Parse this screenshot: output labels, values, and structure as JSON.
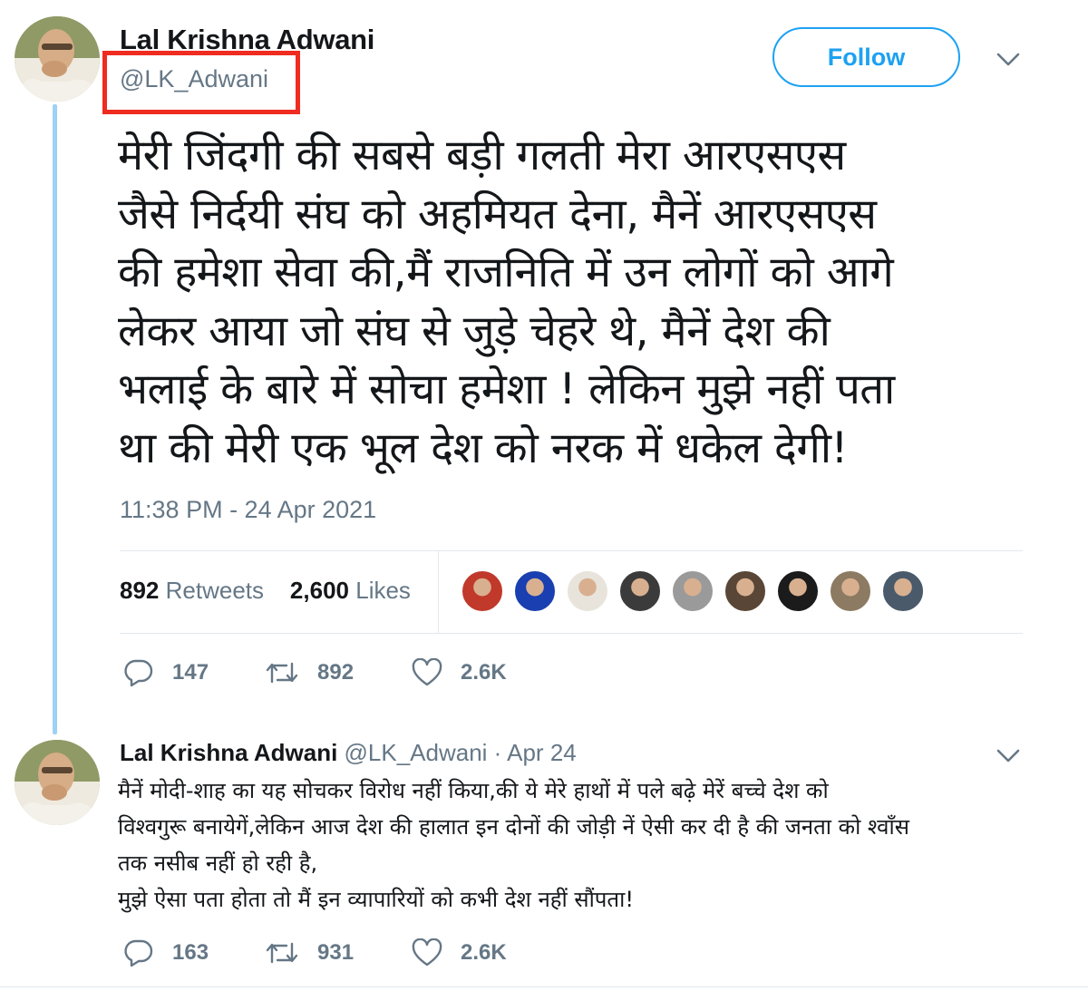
{
  "main_tweet": {
    "author_name": "Lal Krishna Adwani",
    "handle": "@LK_Adwani",
    "follow_label": "Follow",
    "text": "मेरी जिंदगी की सबसे बड़ी गलती मेरा आरएसएस\nजैसे निर्दयी संघ को अहमियत देना,  मैनें आरएसएस\nकी हमेशा सेवा की,मैं राजनिति में उन लोगों को आगे\nलेकर आया जो संघ से जुड़े चेहरे थे, मैनें देश की\nभलाई के बारे में सोचा हमेशा ! लेकिन मुझे नहीं पता\nथा की मेरी एक भूल देश को नरक में धकेल देगी!",
    "timestamp": "11:38 PM - 24 Apr 2021",
    "retweets_count": "892",
    "retweets_label": "Retweets",
    "likes_count": "2,600",
    "likes_label": "Likes",
    "actions": {
      "replies": "147",
      "retweets": "892",
      "likes": "2.6K"
    },
    "liker_avatar_colors": [
      "#c0392b",
      "#1a3fb0",
      "#e8e4dc",
      "#3b3b3b",
      "#9a9a9a",
      "#5a4636",
      "#1b1b1b",
      "#8c7a62",
      "#4a5a6a"
    ]
  },
  "reply_tweet": {
    "author_name": "Lal Krishna Adwani",
    "meta": "@LK_Adwani · Apr 24",
    "text": "मैनें  मोदी-शाह का यह सोचकर विरोध  नहीं किया,की ये मेरे हाथों में पले बढ़े मेरें बच्चे देश को\nविश्वगुरू  बनायेगें,लेकिन आज देश की हालात इन दोनों की जोड़ी नें ऐसी कर दी है की जनता को श्वाँस\nतक नसीब नहीं हो रही है,\n मुझे ऐसा पता होता तो मैं इन  व्यापारियों को कभी देश नहीं सौंपता!",
    "actions": {
      "replies": "163",
      "retweets": "931",
      "likes": "2.6K"
    }
  },
  "colors": {
    "accent": "#1da1f2",
    "highlight_box": "#ef2c20",
    "thread_line": "#9fd0f5",
    "muted": "#657786"
  },
  "icons": [
    "reply-icon",
    "retweet-icon",
    "like-icon",
    "chevron-down-icon"
  ]
}
